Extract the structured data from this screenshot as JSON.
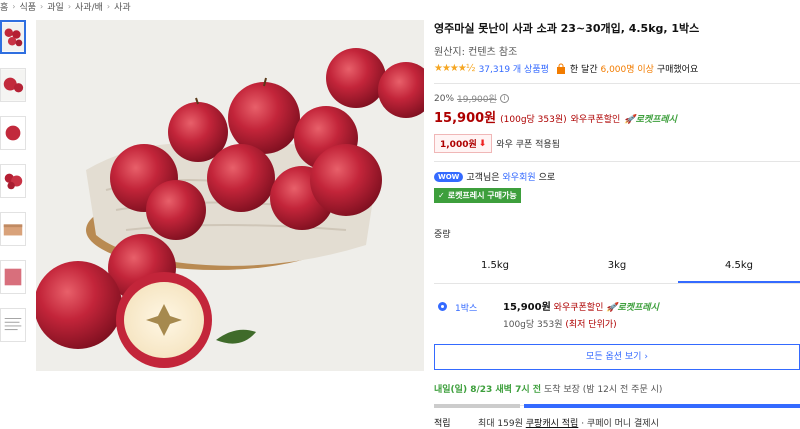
{
  "breadcrumb": [
    "홈",
    "식품",
    "과일",
    "사과/배",
    "사과"
  ],
  "breadcrumb_sep": "›",
  "product": {
    "title": "영주마실 못난이 사과 소과 23~30개입, 4.5kg, 1박스",
    "origin": "원산지: 컨텐츠 참조",
    "stars": "★★★★½",
    "review_count": "37,319 개 상품평",
    "buy_prefix": "한 달간",
    "buy_highlight": "6,000명 이상",
    "buy_suffix": "구매했어요"
  },
  "pricing": {
    "discount_rate": "20%",
    "original_price": "19,900원",
    "info_icon": "i",
    "price": "15,900원",
    "unit_price": "(100g당 353원)",
    "wow_discount": "와우쿠폰할인",
    "rocket_fresh": "로켓프레시",
    "coupon_amount": "1,000원",
    "coupon_text": "와우 쿠폰 적용됨"
  },
  "membership": {
    "wow_badge": "WOW",
    "text_prefix": "고객님은",
    "link": "와우회원",
    "text_suffix": "으로",
    "fresh_badge": "로켓프레시 구매가능"
  },
  "options": {
    "label": "중량",
    "tabs": [
      "1.5kg",
      "3kg",
      "4.5kg"
    ],
    "selected_tab": 2,
    "item": {
      "name": "1박스",
      "price": "15,900원",
      "wow": "와우쿠폰할인",
      "rocket": "로켓프레시",
      "unit_prefix": "100g당 353원",
      "unit_note": "(최저 단위가)"
    },
    "all_button": "모든 옵션 보기"
  },
  "delivery": {
    "eta": "내일(일) 8/23 새벽 7시 전",
    "eta_suffix": "도착 보장",
    "note": "(밤 12시 전 주문 시)"
  },
  "points": {
    "label": "적립",
    "text_prefix": "최대 159원",
    "link": "쿠팡캐시 적립",
    "text_suffix": "· 쿠페이 머니 결제시"
  },
  "colors": {
    "accent_blue": "#346aff",
    "price_red": "#ae0000",
    "fresh_green": "#3d9f3c",
    "star_orange": "#f5a623"
  },
  "icons": [
    "info-icon",
    "bag-icon",
    "coupon-arrow-icon",
    "rocket-icon",
    "radio-selected-icon"
  ]
}
